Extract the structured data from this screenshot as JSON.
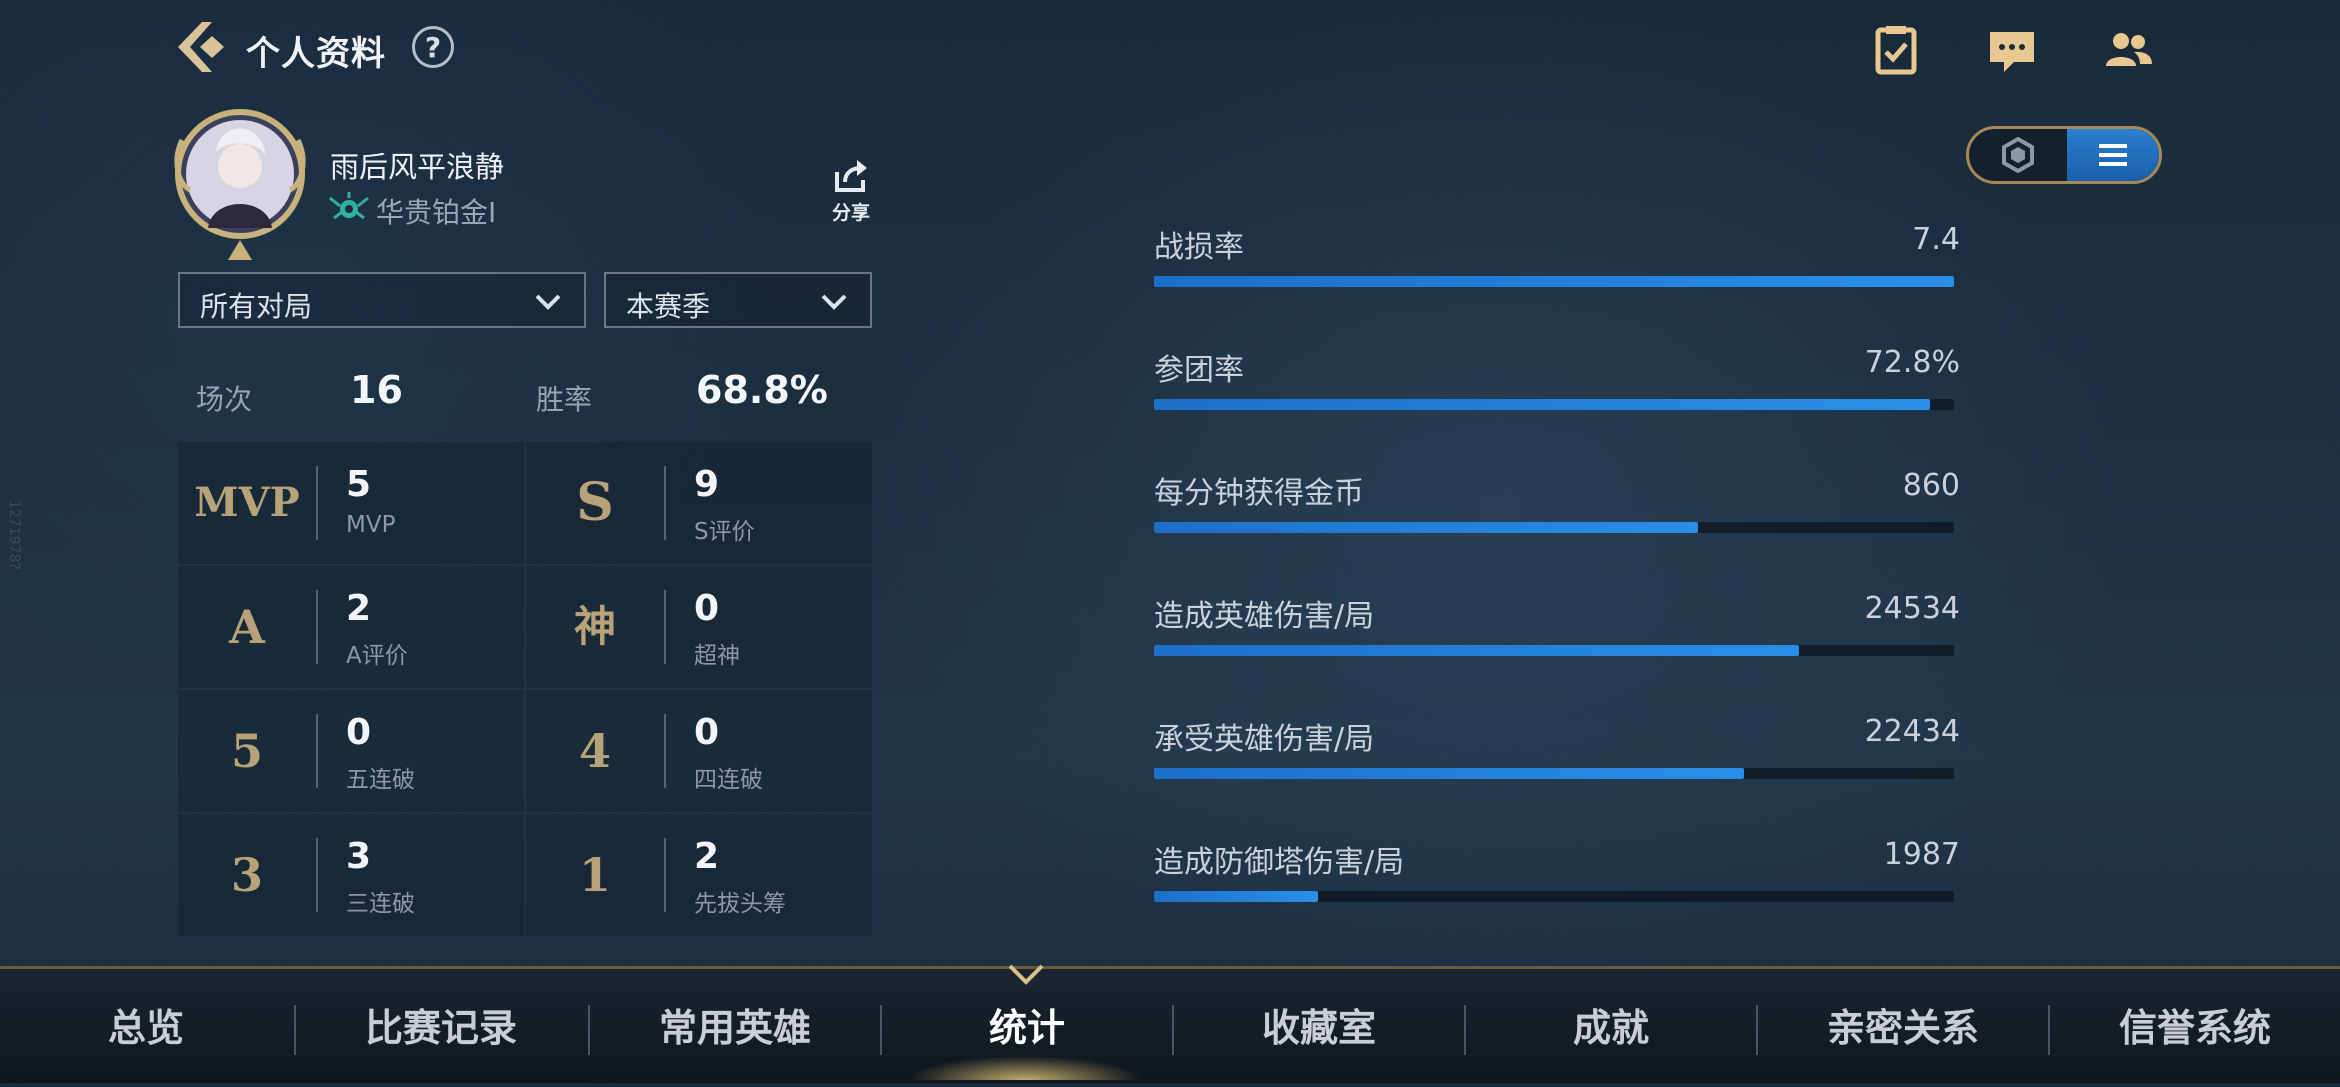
{
  "header": {
    "title": "个人资料",
    "help_label": "?"
  },
  "profile": {
    "name": "雨后风平浪静",
    "rank": "华贵铂金I",
    "share_label": "分享"
  },
  "filters": {
    "mode": "所有对局",
    "season": "本赛季"
  },
  "summary": {
    "games_label": "场次",
    "games_value": "16",
    "winrate_label": "胜率",
    "winrate_value": "68.8%"
  },
  "achievements": [
    {
      "badge": "MVP",
      "value": "5",
      "label": "MVP"
    },
    {
      "badge": "S",
      "value": "9",
      "label": "S评价"
    },
    {
      "badge": "A",
      "value": "2",
      "label": "A评价"
    },
    {
      "badge": "神",
      "value": "0",
      "label": "超神"
    },
    {
      "badge": "5",
      "value": "0",
      "label": "五连破"
    },
    {
      "badge": "4",
      "value": "0",
      "label": "四连破"
    },
    {
      "badge": "3",
      "value": "3",
      "label": "三连破"
    },
    {
      "badge": "1",
      "value": "2",
      "label": "先拔头筹"
    }
  ],
  "stats": [
    {
      "label": "战损率",
      "value": "7.4",
      "fill": 1.0
    },
    {
      "label": "参团率",
      "value": "72.8%",
      "fill": 0.97
    },
    {
      "label": "每分钟获得金币",
      "value": "860",
      "fill": 0.68
    },
    {
      "label": "造成英雄伤害/局",
      "value": "24534",
      "fill": 0.806
    },
    {
      "label": "承受英雄伤害/局",
      "value": "22434",
      "fill": 0.737
    },
    {
      "label": "造成防御塔伤害/局",
      "value": "1987",
      "fill": 0.205
    }
  ],
  "nav": {
    "items": [
      "总览",
      "比赛记录",
      "常用英雄",
      "统计",
      "收藏室",
      "成就",
      "亲密关系",
      "信誉系统"
    ],
    "active": "统计"
  },
  "watermark": "1271978?",
  "colors": {
    "accent_gold": "#b8a27a",
    "bar_blue": "#1d6fc8",
    "toggle_active": "#2c7fcf"
  },
  "icons": {
    "back": "back-arrow-icon",
    "tasks": "clipboard-check-icon",
    "chat": "chat-bubble-icon",
    "friends": "friends-icon",
    "share": "share-icon",
    "rank": "rank-emblem-icon"
  }
}
